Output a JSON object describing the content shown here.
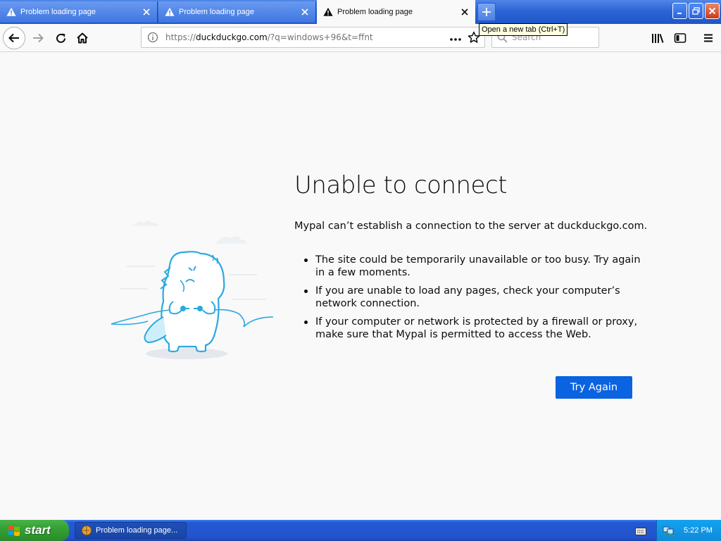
{
  "tabs": [
    {
      "label": "Problem loading page",
      "icon": "warning-icon",
      "active": false
    },
    {
      "label": "Problem loading page",
      "icon": "warning-icon",
      "active": false
    },
    {
      "label": "Problem loading page",
      "icon": "warning-icon",
      "active": true
    }
  ],
  "tooltip": "Open a new tab (Ctrl+T)",
  "urlbar": {
    "scheme": "https://",
    "host": "duckduckgo.com",
    "rest": "/?q=windows+96&t=ffnt"
  },
  "search": {
    "placeholder": "Search"
  },
  "error_page": {
    "title": "Unable to connect",
    "description": "Mypal can’t establish a connection to the server at duckduckgo.com.",
    "bullets": [
      "The site could be temporarily unavailable or too busy. Try again in a few moments.",
      "If you are unable to load any pages, check your computer’s network connection.",
      "If your computer or network is protected by a firewall or proxy, make sure that Mypal is permitted to access the Web."
    ],
    "button": "Try Again"
  },
  "taskbar": {
    "start_label": "start",
    "task_label": "Problem loading page...",
    "clock": "5:22 PM"
  },
  "colors": {
    "accent_button": "#0a63e0",
    "page_bg": "#f9f9fa",
    "illustration": "#2aa9e0"
  }
}
